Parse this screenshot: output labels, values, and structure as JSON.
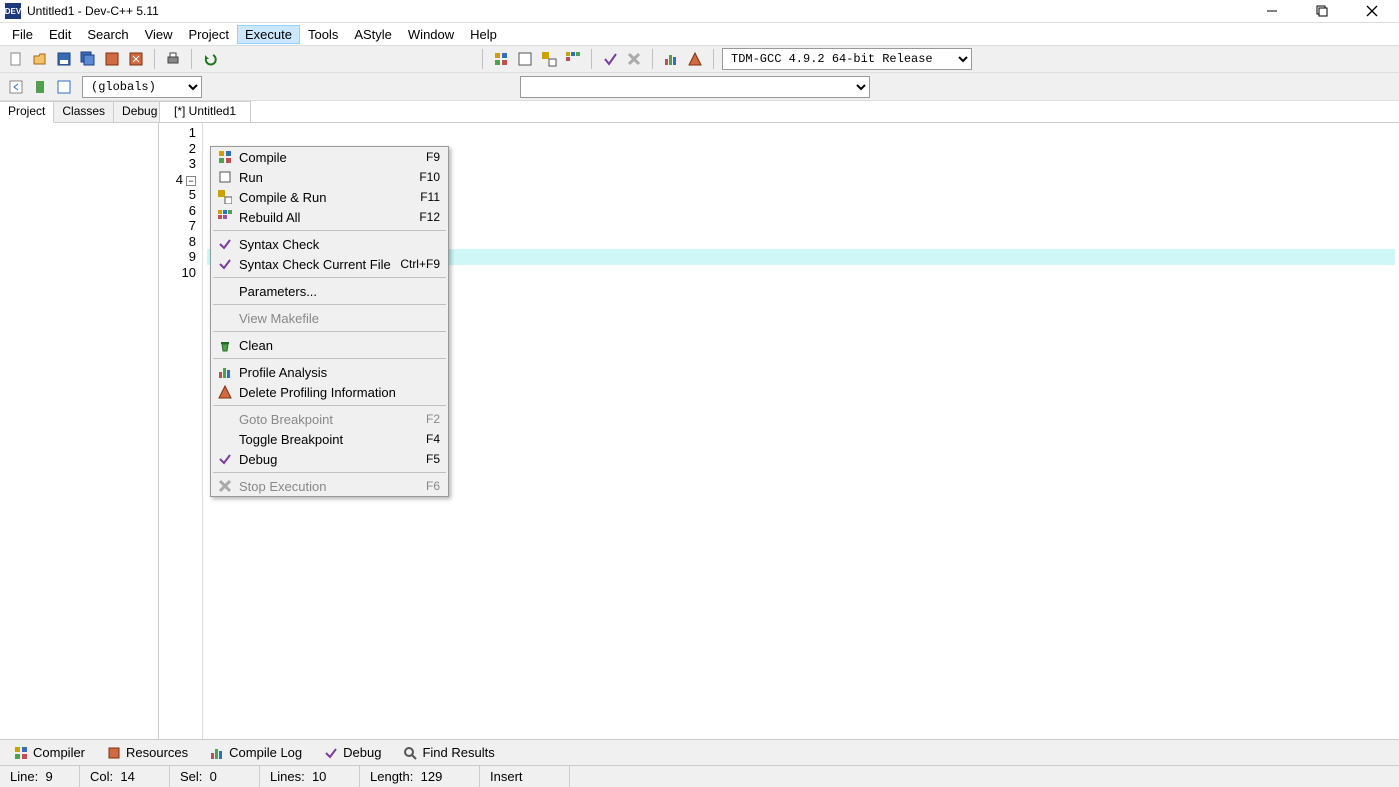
{
  "title": "Untitled1 - Dev-C++ 5.11",
  "menubar": [
    "File",
    "Edit",
    "Search",
    "View",
    "Project",
    "Execute",
    "Tools",
    "AStyle",
    "Window",
    "Help"
  ],
  "active_menu_index": 5,
  "compiler_select": "TDM-GCC 4.9.2 64-bit Release",
  "globals": "(globals)",
  "side_tabs": [
    "Project",
    "Classes",
    "Debug"
  ],
  "active_side_tab": 0,
  "editor_tabs": [
    "[*] Untitled1"
  ],
  "active_editor_tab": 0,
  "line_numbers": [
    "1",
    "2",
    "3",
    "4",
    "5",
    "6",
    "7",
    "8",
    "9",
    "10"
  ],
  "fold_at": 4,
  "highlight_line": 9,
  "dropdown": [
    {
      "icon": "compile",
      "label": "Compile",
      "shortcut": "F9"
    },
    {
      "icon": "run",
      "label": "Run",
      "shortcut": "F10"
    },
    {
      "icon": "compile-run",
      "label": "Compile & Run",
      "shortcut": "F11"
    },
    {
      "icon": "rebuild",
      "label": "Rebuild All",
      "shortcut": "F12"
    },
    {
      "sep": true
    },
    {
      "icon": "syntax",
      "label": "Syntax Check",
      "shortcut": ""
    },
    {
      "icon": "syntax",
      "label": "Syntax Check Current File",
      "shortcut": "Ctrl+F9"
    },
    {
      "sep": true
    },
    {
      "icon": "",
      "label": "Parameters...",
      "shortcut": ""
    },
    {
      "sep": true
    },
    {
      "icon": "",
      "label": "View Makefile",
      "shortcut": "",
      "disabled": true
    },
    {
      "sep": true
    },
    {
      "icon": "clean",
      "label": "Clean",
      "shortcut": ""
    },
    {
      "sep": true
    },
    {
      "icon": "profile",
      "label": "Profile Analysis",
      "shortcut": ""
    },
    {
      "icon": "delete-profile",
      "label": "Delete Profiling Information",
      "shortcut": ""
    },
    {
      "sep": true
    },
    {
      "icon": "",
      "label": "Goto Breakpoint",
      "shortcut": "F2",
      "disabled": true
    },
    {
      "icon": "",
      "label": "Toggle Breakpoint",
      "shortcut": "F4"
    },
    {
      "icon": "debug",
      "label": "Debug",
      "shortcut": "F5"
    },
    {
      "sep": true
    },
    {
      "icon": "stop",
      "label": "Stop Execution",
      "shortcut": "F6",
      "disabled": true
    }
  ],
  "bottom_tabs": [
    "Compiler",
    "Resources",
    "Compile Log",
    "Debug",
    "Find Results"
  ],
  "status": {
    "line_lbl": "Line:",
    "line": "9",
    "col_lbl": "Col:",
    "col": "14",
    "sel_lbl": "Sel:",
    "sel": "0",
    "lines_lbl": "Lines:",
    "lines": "10",
    "length_lbl": "Length:",
    "length": "129",
    "mode": "Insert"
  }
}
